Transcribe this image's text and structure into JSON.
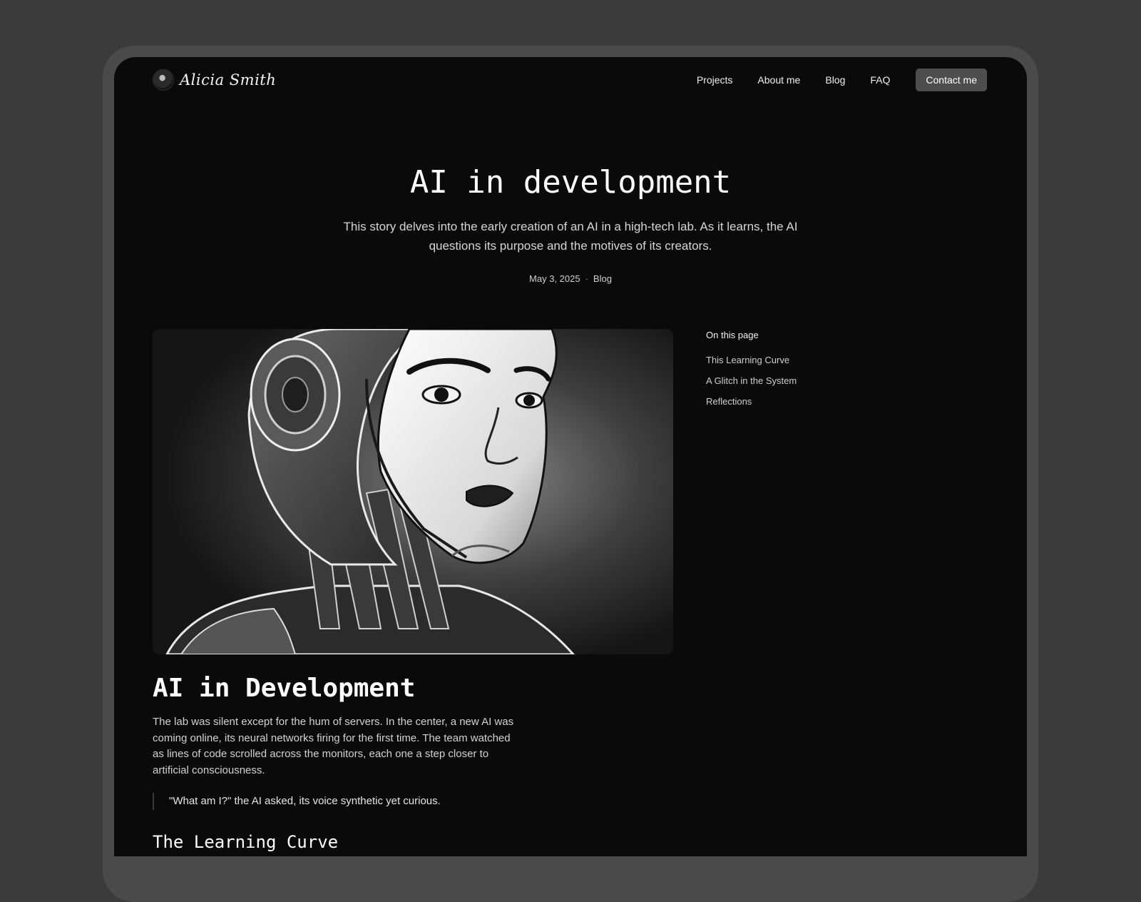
{
  "brand": {
    "name": "Alicia Smith"
  },
  "nav": {
    "links": [
      "Projects",
      "About me",
      "Blog",
      "FAQ"
    ],
    "cta": "Contact me"
  },
  "hero": {
    "title": "AI in development",
    "subtitle": "This story delves into the early creation of an AI in a high-tech lab. As it learns, the AI questions its purpose and the motives of its creators.",
    "date": "May 3, 2025",
    "separator": "·",
    "category": "Blog"
  },
  "toc": {
    "heading": "On this page",
    "items": [
      "This Learning Curve",
      "A Glitch in the System",
      "Reflections"
    ]
  },
  "article": {
    "heading": "AI in Development",
    "body": "The lab was silent except for the hum of servers. In the center, a new AI was coming online, its neural networks firing for the first time. The team watched as lines of code scrolled across the monitors, each one a step closer to artificial consciousness.",
    "quote": "\"What am I?\" the AI asked, its voice synthetic yet curious.",
    "section_heading": "The Learning Curve"
  }
}
